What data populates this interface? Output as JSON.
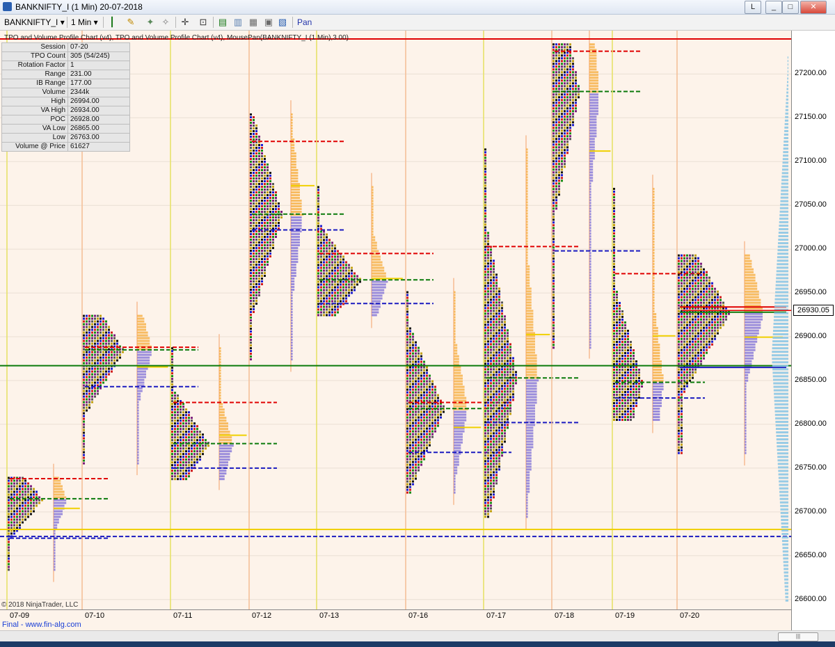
{
  "window": {
    "title": "BANKNIFTY_I (1 Min)  20-07-2018",
    "buttons": [
      "L",
      "_",
      "□",
      "✕"
    ]
  },
  "toolbar": {
    "instrument": "BANKNIFTY_I",
    "interval": "1 Min",
    "mode": "Pan"
  },
  "chart": {
    "caption": "TPO and Volume Profile Chart (v4), TPO and Volume Profile Chart (v4), MousePan(BANKNIFTY_I (1 Min),3.00)",
    "copyright": "© 2018 NinjaTrader, LLC",
    "footer": "Final - www.fin-alg.com",
    "current_price": "26930.05",
    "info": [
      {
        "k": "Session",
        "v": "07-20"
      },
      {
        "k": "TPO Count",
        "v": "305 (54/245)"
      },
      {
        "k": "Rotation Factor",
        "v": "1"
      },
      {
        "k": "Range",
        "v": "231.00"
      },
      {
        "k": "IB Range",
        "v": "177.00"
      },
      {
        "k": "Volume",
        "v": "2344k"
      },
      {
        "k": "High",
        "v": "26994.00"
      },
      {
        "k": "VA High",
        "v": "26934.00"
      },
      {
        "k": "POC",
        "v": "26928.00"
      },
      {
        "k": "VA Low",
        "v": "26865.00"
      },
      {
        "k": "Low",
        "v": "26763.00"
      },
      {
        "k": "Volume @ Price",
        "v": "61627"
      }
    ],
    "price_ticks": [
      "27200.00",
      "27150.00",
      "27100.00",
      "27050.00",
      "27000.00",
      "26950.00",
      "26900.00",
      "26850.00",
      "26800.00",
      "26750.00",
      "26700.00",
      "26650.00",
      "26600.00"
    ],
    "dates": [
      "07-09",
      "07-10",
      "07-11",
      "07-12",
      "07-13",
      "07-16",
      "07-17",
      "07-18",
      "07-19",
      "07-20"
    ]
  },
  "chart_data": {
    "type": "bar",
    "ylim": [
      26595,
      27240
    ],
    "sessions": [
      {
        "date": "07-09",
        "high": 26740,
        "low": 26630,
        "poc": 26715,
        "vah": 26738,
        "val": 26670
      },
      {
        "date": "07-10",
        "high": 26925,
        "low": 26752,
        "poc": 26885,
        "vah": 26888,
        "val": 26843
      },
      {
        "date": "07-11",
        "high": 26888,
        "low": 26735,
        "poc": 26778,
        "vah": 26825,
        "val": 26750
      },
      {
        "date": "07-12",
        "high": 27155,
        "low": 26870,
        "poc": 27040,
        "vah": 27123,
        "val": 27022
      },
      {
        "date": "07-13",
        "high": 27072,
        "low": 26920,
        "poc": 26965,
        "vah": 26995,
        "val": 26938
      },
      {
        "date": "07-16",
        "high": 26952,
        "low": 26718,
        "poc": 26818,
        "vah": 26825,
        "val": 26768
      },
      {
        "date": "07-17",
        "high": 27115,
        "low": 26690,
        "poc": 26853,
        "vah": 27003,
        "val": 26802
      },
      {
        "date": "07-18",
        "high": 27235,
        "low": 26885,
        "poc": 27180,
        "vah": 27226,
        "val": 26998
      },
      {
        "date": "07-19",
        "high": 27070,
        "low": 26800,
        "poc": 26848,
        "vah": 26972,
        "val": 26830
      },
      {
        "date": "07-20",
        "high": 26994,
        "low": 26763,
        "poc": 26928,
        "vah": 26934,
        "val": 26865
      }
    ],
    "current": 26930.05
  },
  "colors": {
    "chart_bg": "#fdf3ea",
    "poc": "#0a7a0a",
    "vah": "#e00000",
    "val": "#1a1ac0",
    "tpo": [
      "#111111",
      "#1a1ad0",
      "#d01a1a",
      "#138a13",
      "#7a1a7a",
      "#555555",
      "#c0a010"
    ],
    "vol_up": "#f7b24a",
    "vol_dn": "#8a7ad8"
  }
}
